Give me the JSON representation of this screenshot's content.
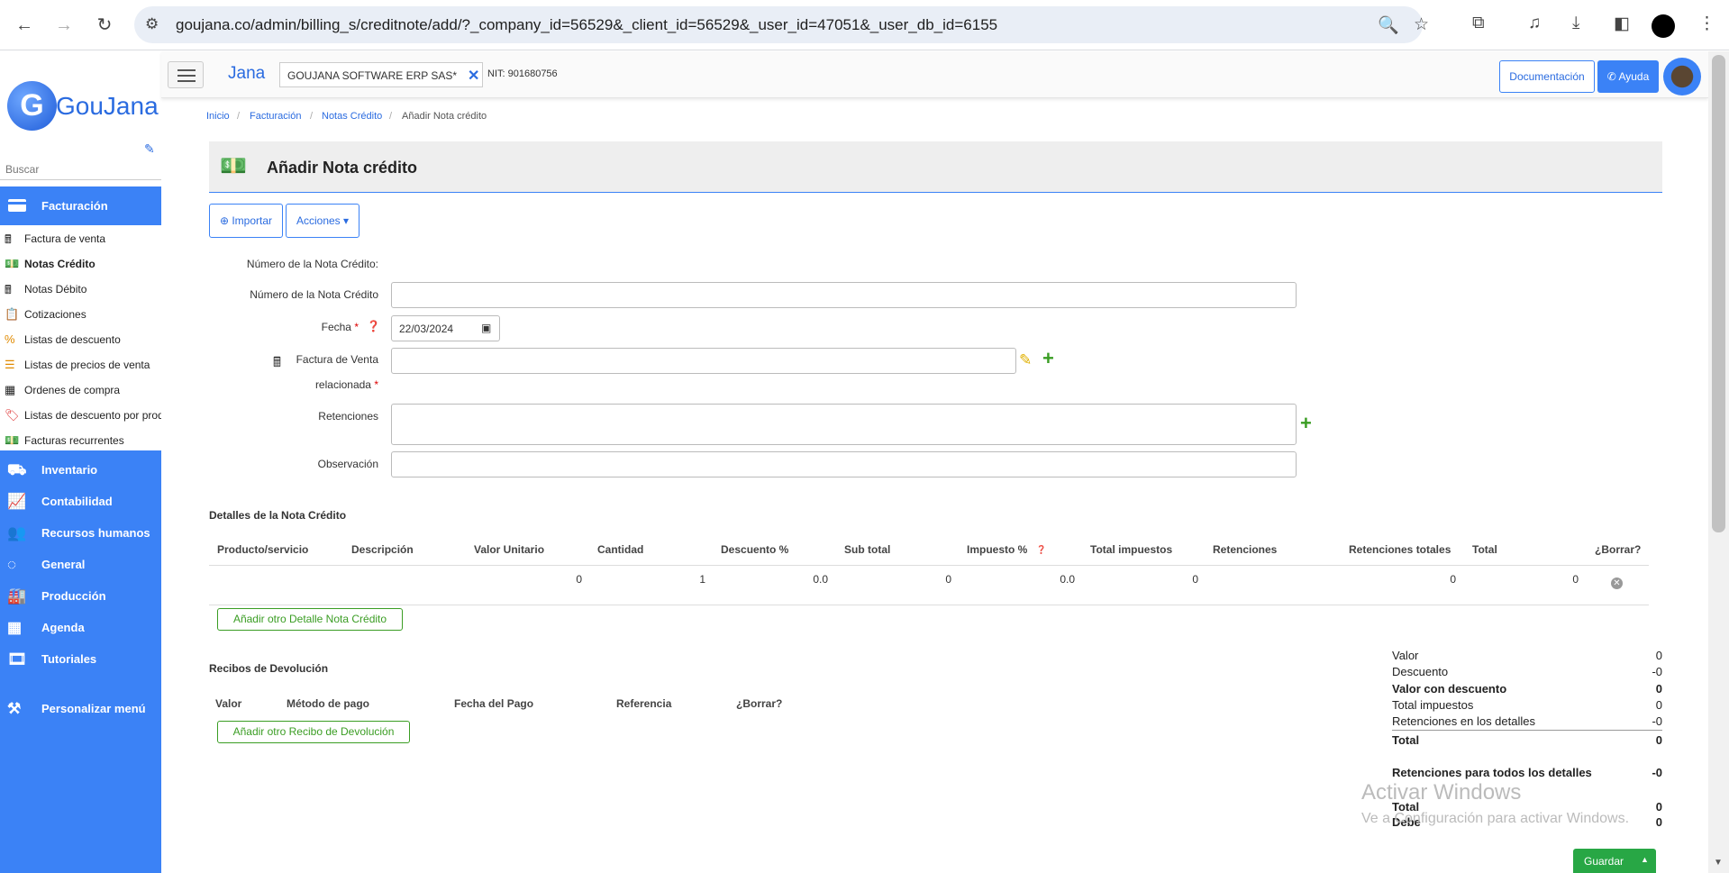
{
  "browser": {
    "url": "goujana.co/admin/billing_s/creditnote/add/?_company_id=56529&_client_id=56529&_user_id=47051&_user_db_id=6155"
  },
  "sidebar": {
    "logo_text": "GouJana",
    "logo_letter": "G",
    "search_placeholder": "Buscar",
    "active_section": "Facturación",
    "sub_items": [
      {
        "label": "Factura de venta",
        "icon": "cash-register-icon"
      },
      {
        "label": "Notas Crédito",
        "icon": "money-icon",
        "active": true
      },
      {
        "label": "Notas Débito",
        "icon": "cash-register-icon"
      },
      {
        "label": "Cotizaciones",
        "icon": "clipboard-icon"
      },
      {
        "label": "Listas de descuento",
        "icon": "percent-icon"
      },
      {
        "label": "Listas de precios de venta",
        "icon": "list-icon"
      },
      {
        "label": "Ordenes de compra",
        "icon": "calculator-icon"
      },
      {
        "label": "Listas de descuento por producto",
        "icon": "tag-icon"
      },
      {
        "label": "Facturas recurrentes",
        "icon": "money-icon"
      }
    ],
    "main_items": [
      {
        "label": "Inventario",
        "icon": "truck-icon"
      },
      {
        "label": "Contabilidad",
        "icon": "chart-line-icon"
      },
      {
        "label": "Recursos humanos",
        "icon": "users-icon"
      },
      {
        "label": "General",
        "icon": "circle-notch-icon"
      },
      {
        "label": "Producción",
        "icon": "industry-icon"
      },
      {
        "label": "Agenda",
        "icon": "calendar-icon"
      },
      {
        "label": "Tutoriales",
        "icon": "film-icon"
      },
      {
        "label": "Personalizar menú",
        "icon": "tools-icon"
      }
    ]
  },
  "topbar": {
    "brand": "Jana",
    "company": "GOUJANA SOFTWARE ERP SAS*",
    "nit": "NIT: 901680756",
    "doc_button": "Documentación",
    "help_button": "Ayuda"
  },
  "breadcrumb": {
    "items": [
      "Inicio",
      "Facturación",
      "Notas Crédito"
    ],
    "current": "Añadir Nota crédito"
  },
  "page": {
    "title": "Añadir Nota crédito",
    "import_button": "Importar",
    "actions_button": "Acciones"
  },
  "form": {
    "number_static_label": "Número de la Nota Crédito:",
    "number_label": "Número de la Nota Crédito",
    "number_value": "",
    "date_label": "Fecha",
    "date_value": "22/03/2024",
    "invoice_label_1": "Factura de Venta",
    "invoice_label_2": "relacionada",
    "invoice_value": "",
    "retentions_label": "Retenciones",
    "observation_label": "Observación",
    "required_mark": "*"
  },
  "details": {
    "title": "Detalles de la Nota Crédito",
    "columns": [
      "Producto/servicio",
      "Descripción",
      "Valor Unitario",
      "Cantidad",
      "Descuento %",
      "Sub total",
      "Impuesto %",
      "Total impuestos",
      "Retenciones",
      "Retenciones totales",
      "Total",
      "¿Borrar?"
    ],
    "row": {
      "valor_unitario": "0",
      "cantidad": "1",
      "descuento": "0.0",
      "sub_total": "0",
      "impuesto": "0.0",
      "total_impuestos": "0",
      "retenciones_totales": "0",
      "total": "0"
    },
    "add_button": "Añadir otro Detalle Nota Crédito"
  },
  "receipts": {
    "title": "Recibos de Devolución",
    "columns": [
      "Valor",
      "Método de pago",
      "Fecha del Pago",
      "Referencia",
      "¿Borrar?"
    ],
    "add_button": "Añadir otro Recibo de Devolución"
  },
  "totals": {
    "valor_label": "Valor",
    "valor": "0",
    "descuento_label": "Descuento",
    "descuento": "-0",
    "valor_con_descuento_label": "Valor con descuento",
    "valor_con_descuento": "0",
    "total_impuestos_label": "Total impuestos",
    "total_impuestos": "0",
    "retenciones_detalles_label": "Retenciones en los detalles",
    "retenciones_detalles": "-0",
    "total_label": "Total",
    "total": "0",
    "retenciones_todos_label": "Retenciones para todos los detalles",
    "retenciones_todos": "-0",
    "total2_label": "Total",
    "total2": "0",
    "debe_label": "Debe",
    "debe": "0"
  },
  "watermark": {
    "line1": "Activar Windows",
    "line2": "Ve a Configuración para activar Windows."
  },
  "save_button": "Guardar",
  "colors": {
    "primary": "#3b82f6",
    "success": "#28a745",
    "link": "#2a6be0"
  }
}
